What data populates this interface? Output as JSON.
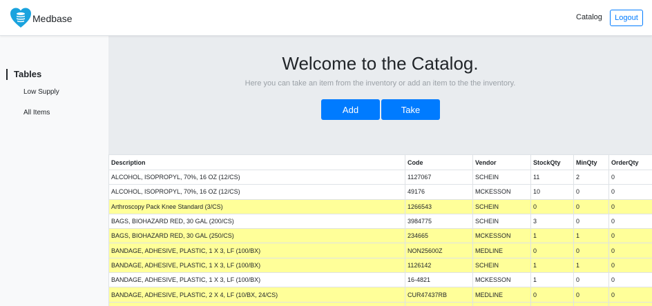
{
  "app": {
    "brand_name": "Medbase",
    "logo_icon": "heart-stack-icon",
    "brand_color": "#1aa3de"
  },
  "navbar": {
    "catalog_link": "Catalog",
    "logout_button": "Logout"
  },
  "sidebar": {
    "header": "Tables",
    "items": [
      {
        "label": "Low Supply"
      },
      {
        "label": "All Items"
      }
    ]
  },
  "jumbotron": {
    "title": "Welcome to the Catalog.",
    "subtitle": "Here you can take an item from the inventory or add an item to the the inventory.",
    "add_button": "Add",
    "take_button": "Take"
  },
  "table": {
    "headers": [
      "Description",
      "Code",
      "Vendor",
      "StockQty",
      "MinQty",
      "OrderQty"
    ],
    "highlight_color": "#ffff99",
    "rows": [
      {
        "low": false,
        "cells": [
          "ALCOHOL, ISOPROPYL, 70%, 16 OZ (12/CS)",
          "1127067",
          "SCHEIN",
          "11",
          "2",
          "0"
        ]
      },
      {
        "low": false,
        "cells": [
          "ALCOHOL, ISOPROPYL, 70%, 16 OZ (12/CS)",
          "49176",
          "MCKESSON",
          "10",
          "0",
          "0"
        ]
      },
      {
        "low": true,
        "cells": [
          "Arthroscopy Pack Knee Standard (3/CS)",
          "1266543",
          "SCHEIN",
          "0",
          "0",
          "0"
        ]
      },
      {
        "low": false,
        "cells": [
          "BAGS, BIOHAZARD RED, 30 GAL (200/CS)",
          "3984775",
          "SCHEIN",
          "3",
          "0",
          "0"
        ]
      },
      {
        "low": true,
        "cells": [
          "BAGS, BIOHAZARD RED, 30 GAL (250/CS)",
          "234665",
          "MCKESSON",
          "1",
          "1",
          "0"
        ]
      },
      {
        "low": true,
        "cells": [
          "BANDAGE, ADHESIVE, PLASTIC, 1 X 3, LF (100/BX)",
          "NON25600Z",
          "MEDLINE",
          "0",
          "0",
          "0"
        ]
      },
      {
        "low": true,
        "cells": [
          "BANDAGE, ADHESIVE, PLASTIC, 1 X 3, LF (100/BX)",
          "1126142",
          "SCHEIN",
          "1",
          "1",
          "0"
        ]
      },
      {
        "low": false,
        "cells": [
          "BANDAGE, ADHESIVE, PLASTIC, 1 X 3, LF (100/BX)",
          "16-4821",
          "MCKESSON",
          "1",
          "0",
          "0"
        ]
      },
      {
        "low": true,
        "cells": [
          "BANDAGE, ADHESIVE, PLASTIC, 2 X 4, LF (10/BX, 24/CS)",
          "CUR47437RB",
          "MEDLINE",
          "0",
          "0",
          "0"
        ]
      },
      {
        "low": true,
        "cells": [
          "",
          "",
          "",
          "",
          "",
          ""
        ]
      }
    ]
  }
}
